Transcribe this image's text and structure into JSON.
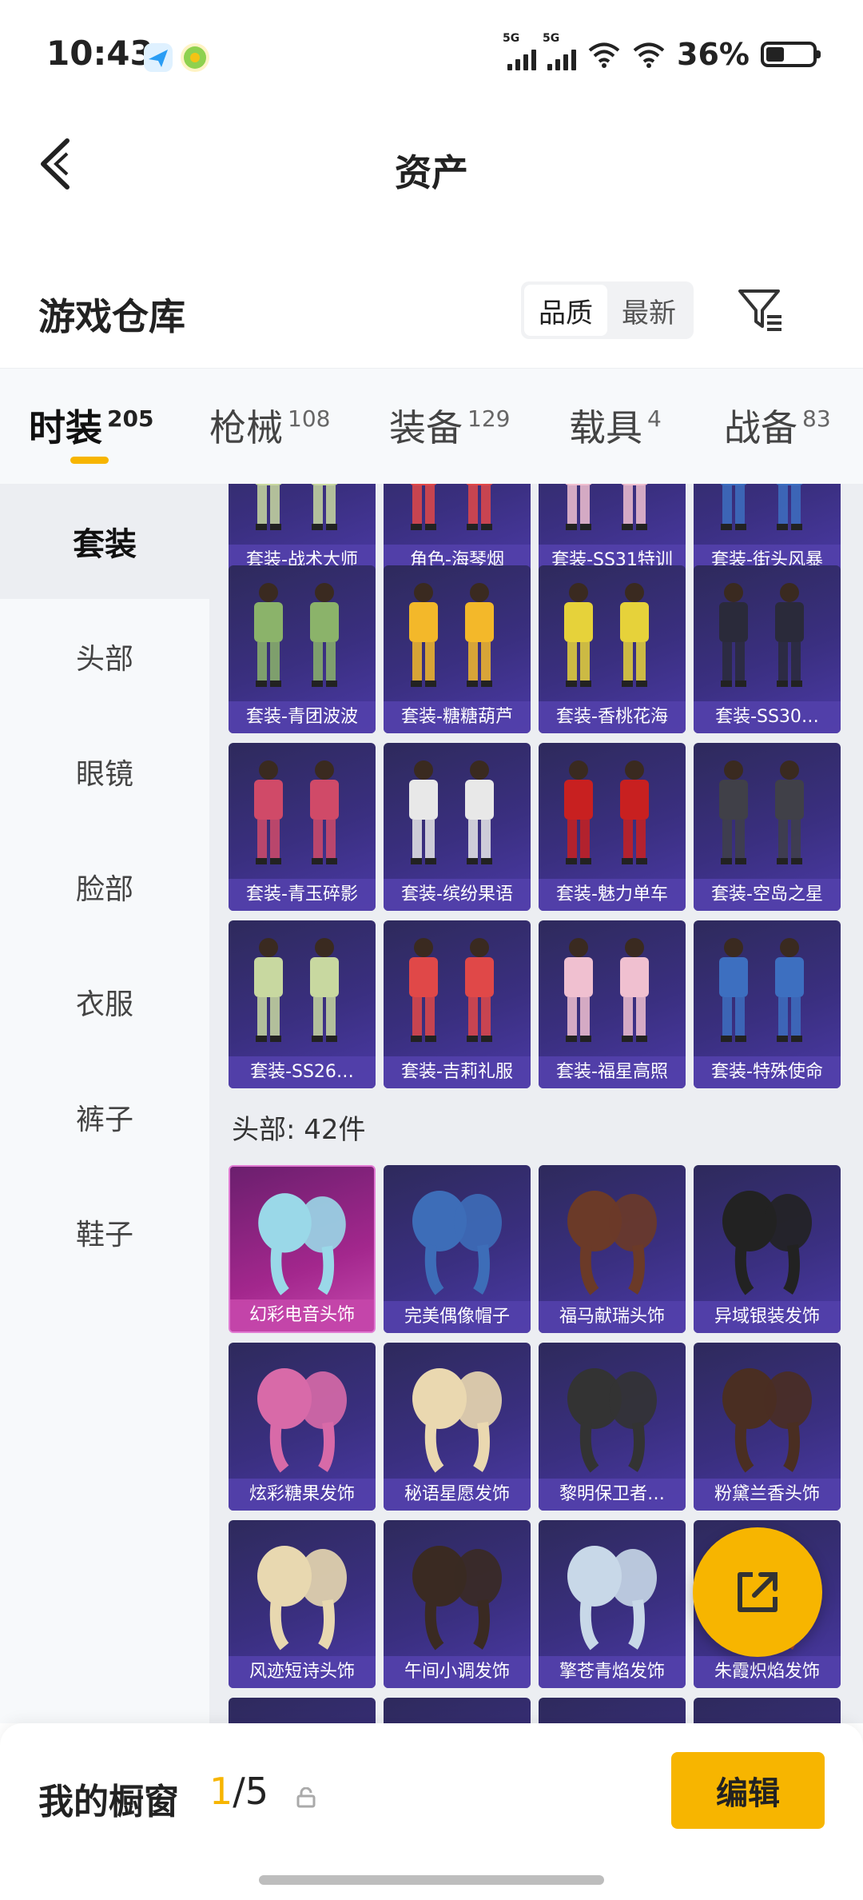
{
  "status_bar": {
    "time": "10:43",
    "battery": "36%"
  },
  "header": {
    "title": "资产"
  },
  "warehouse": {
    "title": "游戏仓库",
    "sort_options": [
      "品质",
      "最新"
    ]
  },
  "tabs": [
    {
      "label": "时装",
      "count": "205"
    },
    {
      "label": "枪械",
      "count": "108"
    },
    {
      "label": "装备",
      "count": "129"
    },
    {
      "label": "载具",
      "count": "4"
    },
    {
      "label": "战备",
      "count": "83"
    }
  ],
  "sidebar": {
    "items": [
      "套装",
      "头部",
      "眼镜",
      "脸部",
      "衣服",
      "裤子",
      "鞋子"
    ]
  },
  "outfits": [
    "套装-战术大师",
    "角色-海琴烟",
    "套装-SS31特训",
    "套装-街头风暴",
    "套装-青团波波",
    "套装-糖糖葫芦",
    "套装-香桃花海",
    "套装-SS30…",
    "套装-青玉碎影",
    "套装-缤纷果语",
    "套装-魅力单车",
    "套装-空岛之星",
    "套装-SS26…",
    "套装-吉莉礼服",
    "套装-福星高照",
    "套装-特殊使命"
  ],
  "head_section": {
    "title": "头部: 42件",
    "items": [
      "幻彩电音头饰",
      "完美偶像帽子",
      "福马献瑞头饰",
      "异域银装发饰",
      "炫彩糖果发饰",
      "秘语星愿发饰",
      "黎明保卫者…",
      "粉黛兰香头饰",
      "风迹短诗头饰",
      "午间小调发饰",
      "擎苍青焰发饰",
      "朱霞炽焰发饰"
    ]
  },
  "showcase": {
    "title": "我的橱窗",
    "current": "1",
    "total": "/5",
    "edit_label": "编辑"
  },
  "colors": {
    "accent": "#f7b500",
    "card_bg": "#3a2f80",
    "card_label": "#5240aa",
    "highlight_card": "#a3278d"
  }
}
